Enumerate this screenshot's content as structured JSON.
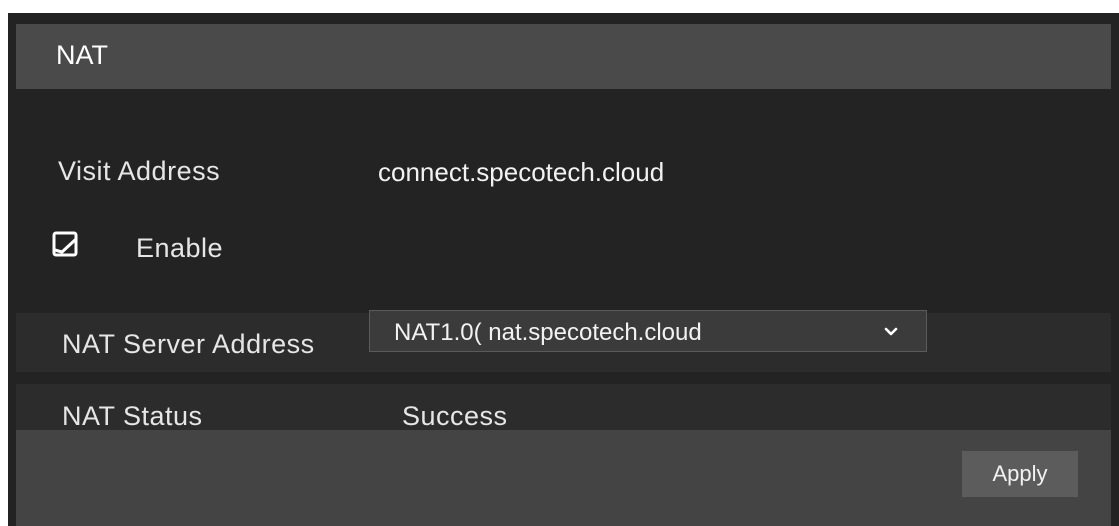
{
  "header": {
    "title": "NAT"
  },
  "visit_address": {
    "label": "Visit Address",
    "value": "connect.specotech.cloud"
  },
  "enable": {
    "label": "Enable",
    "checked": true
  },
  "nat_server": {
    "label": "NAT Server Address",
    "selected": "NAT1.0( nat.specotech.cloud"
  },
  "nat_status": {
    "label": "NAT Status",
    "value": "Success"
  },
  "footer": {
    "apply_label": "Apply"
  },
  "icons": {
    "checkbox": "checkbox-checked-icon",
    "dropdown": "chevron-down-icon"
  },
  "colors": {
    "panel_bg": "#232323",
    "header_bg": "#4a4a4a",
    "footer_bg": "#444444",
    "button_bg": "#5c5c5c",
    "text": "#f2f2f2"
  }
}
